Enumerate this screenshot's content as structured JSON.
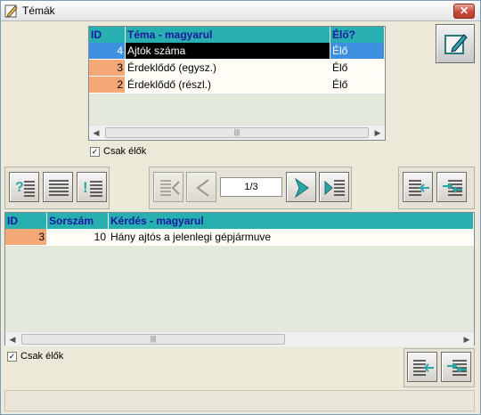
{
  "window": {
    "title": "Témák",
    "close_symbol": "✕"
  },
  "topics_grid": {
    "columns": [
      "ID",
      "Téma - magyarul",
      "Élő?"
    ],
    "rows": [
      {
        "id": "4",
        "title": "Ajtók száma",
        "live": "Élő",
        "selected": true
      },
      {
        "id": "3",
        "title": "Érdeklődő (egysz.)",
        "live": "Élő",
        "selected": false
      },
      {
        "id": "2",
        "title": "Érdeklődő (részl.)",
        "live": "Élő",
        "selected": false
      }
    ],
    "only_live_label": "Csak élők",
    "only_live_checked": true
  },
  "navigation": {
    "page_counter": "1/3"
  },
  "questions_grid": {
    "columns": [
      "ID",
      "Sorszám",
      "Kérdés - magyarul"
    ],
    "rows": [
      {
        "id": "3",
        "order": "10",
        "question": "Hány ajtós a jelenlegi gépjármuve"
      }
    ],
    "only_live_label": "Csak élők",
    "only_live_checked": true
  },
  "icons": {
    "app": "edit-pencil-icon",
    "edit": "edit-document-icon",
    "help_list": "question-list-icon",
    "list": "list-icon",
    "alert_list": "exclamation-list-icon",
    "first": "first-record-icon",
    "prev": "previous-record-icon",
    "next": "next-record-icon",
    "last": "last-record-icon",
    "import": "import-icon",
    "export": "export-icon"
  },
  "colors": {
    "header_bg": "#28b0b0",
    "header_text": "#1a1aa0",
    "id_cell": "#f3a876",
    "selected": "#3d8fe0",
    "nav_arrow": "#2aa6a6"
  }
}
